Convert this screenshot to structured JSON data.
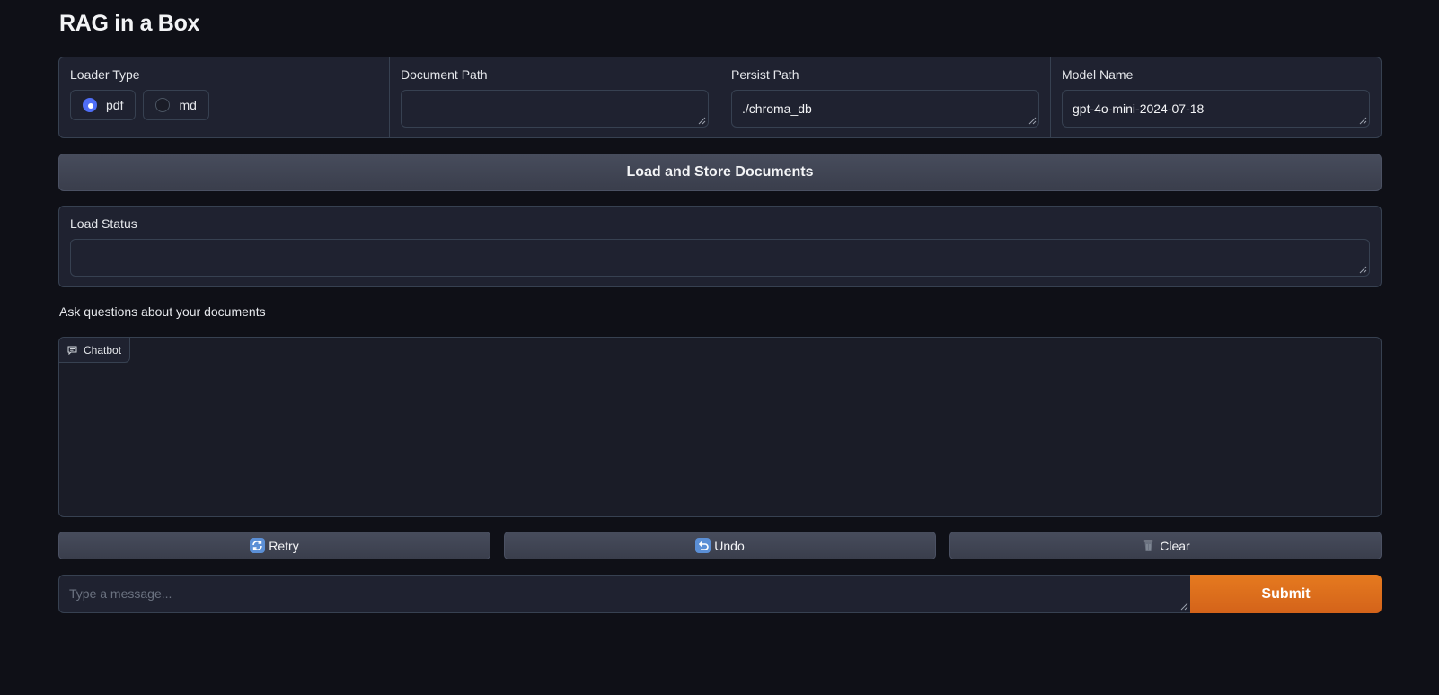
{
  "app": {
    "title": "RAG in a Box"
  },
  "loader": {
    "label": "Loader Type",
    "options": [
      {
        "label": "pdf",
        "selected": true
      },
      {
        "label": "md",
        "selected": false
      }
    ]
  },
  "document_path": {
    "label": "Document Path",
    "value": ""
  },
  "persist_path": {
    "label": "Persist Path",
    "value": "./chroma_db"
  },
  "model_name": {
    "label": "Model Name",
    "value": "gpt-4o-mini-2024-07-18"
  },
  "load_button": {
    "label": "Load and Store Documents"
  },
  "load_status": {
    "label": "Load Status",
    "value": ""
  },
  "chat": {
    "heading": "Ask questions about your documents",
    "tab_label": "Chatbot",
    "retry_label": "Retry",
    "undo_label": "Undo",
    "clear_label": "Clear",
    "placeholder": "Type a message...",
    "submit_label": "Submit"
  },
  "colors": {
    "background": "#0f1017",
    "panel": "#1f2230",
    "accent_radio": "#4f6ef7",
    "submit": "#e57a1f"
  }
}
